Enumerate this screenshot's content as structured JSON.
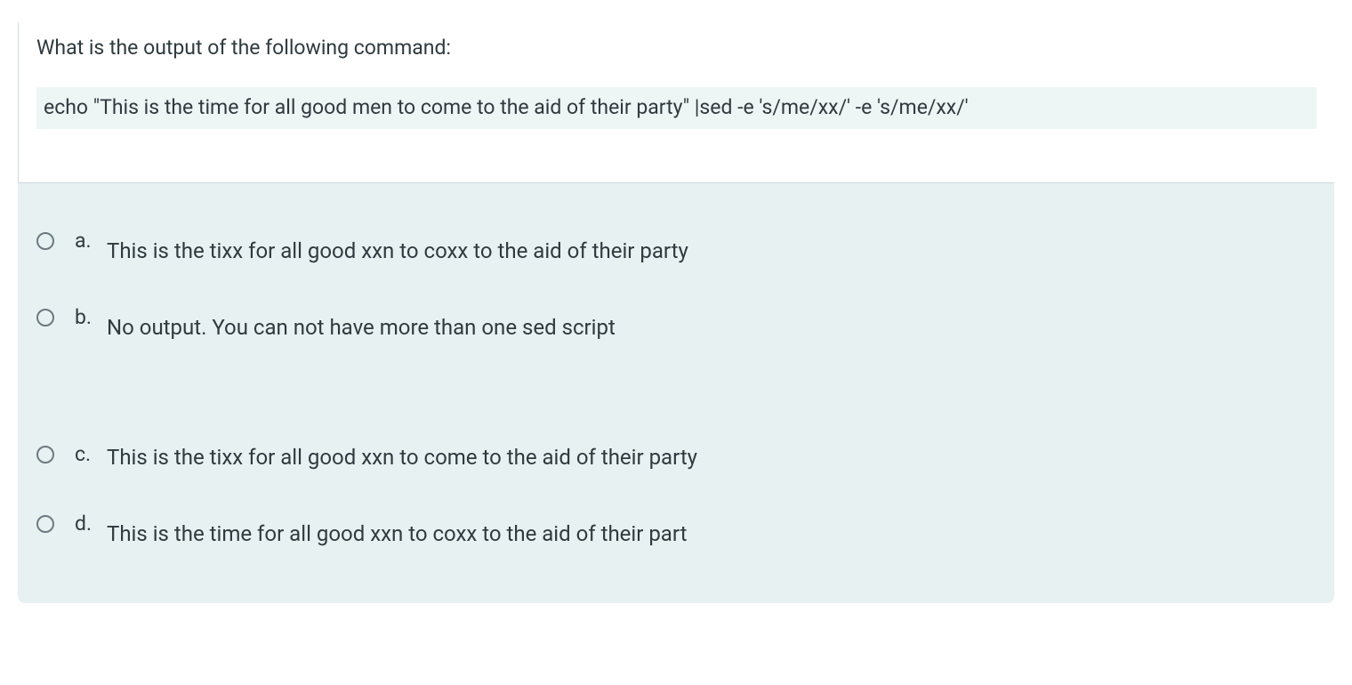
{
  "question": {
    "prompt": "What is the output of the following command:",
    "code": "echo \"This is the time for all good men to come to the aid of their party\" |sed -e 's/me/xx/' -e 's/me/xx/'"
  },
  "options": [
    {
      "letter": "a.",
      "text": "This is the tixx for all good xxn to coxx to the aid of their party"
    },
    {
      "letter": "b.",
      "text": "No output. You can not have more than one sed script"
    },
    {
      "letter": "c.",
      "text": "This is the tixx for all good xxn to come to the aid of their party"
    },
    {
      "letter": "d.",
      "text": "This is the time for all good xxn to coxx to the aid of their part"
    }
  ]
}
